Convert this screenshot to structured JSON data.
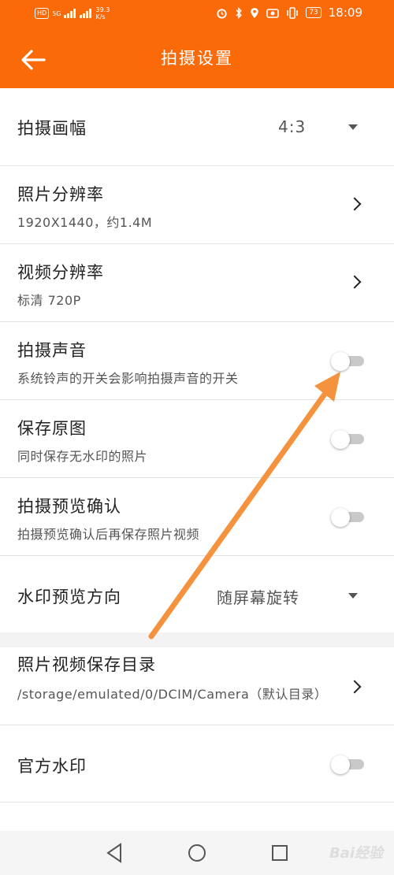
{
  "status_bar": {
    "badge_hd": "HD",
    "badge_5g": "5G",
    "net_speed_value": "39.3",
    "net_speed_unit": "K/s",
    "battery": "73",
    "time": "18:09"
  },
  "header": {
    "title": "拍摄设置"
  },
  "settings": {
    "aspect": {
      "label": "拍摄画幅",
      "value": "4:3"
    },
    "photo_resolution": {
      "label": "照片分辨率",
      "value": "1920X1440，约1.4M"
    },
    "video_resolution": {
      "label": "视频分辨率",
      "value": "标清 720P"
    },
    "shutter_sound": {
      "label": "拍摄声音",
      "desc": "系统铃声的开关会影响拍摄声音的开关",
      "enabled": false
    },
    "save_original": {
      "label": "保存原图",
      "desc": "同时保存无水印的照片",
      "enabled": false
    },
    "preview_confirm": {
      "label": "拍摄预览确认",
      "desc": "拍摄预览确认后再保存照片视频",
      "enabled": false
    },
    "watermark_direction": {
      "label": "水印预览方向",
      "value": "随屏幕旋转"
    },
    "save_directory": {
      "label": "照片视频保存目录",
      "value": "/storage/emulated/0/DCIM/Camera（默认目录）"
    },
    "official_watermark": {
      "label": "官方水印",
      "enabled": false
    }
  },
  "nav": {
    "watermark": "Bai经验"
  },
  "colors": {
    "accent": "#fb6a09",
    "arrow": "#f5923e",
    "toggle_off": "#c9c9c9"
  }
}
